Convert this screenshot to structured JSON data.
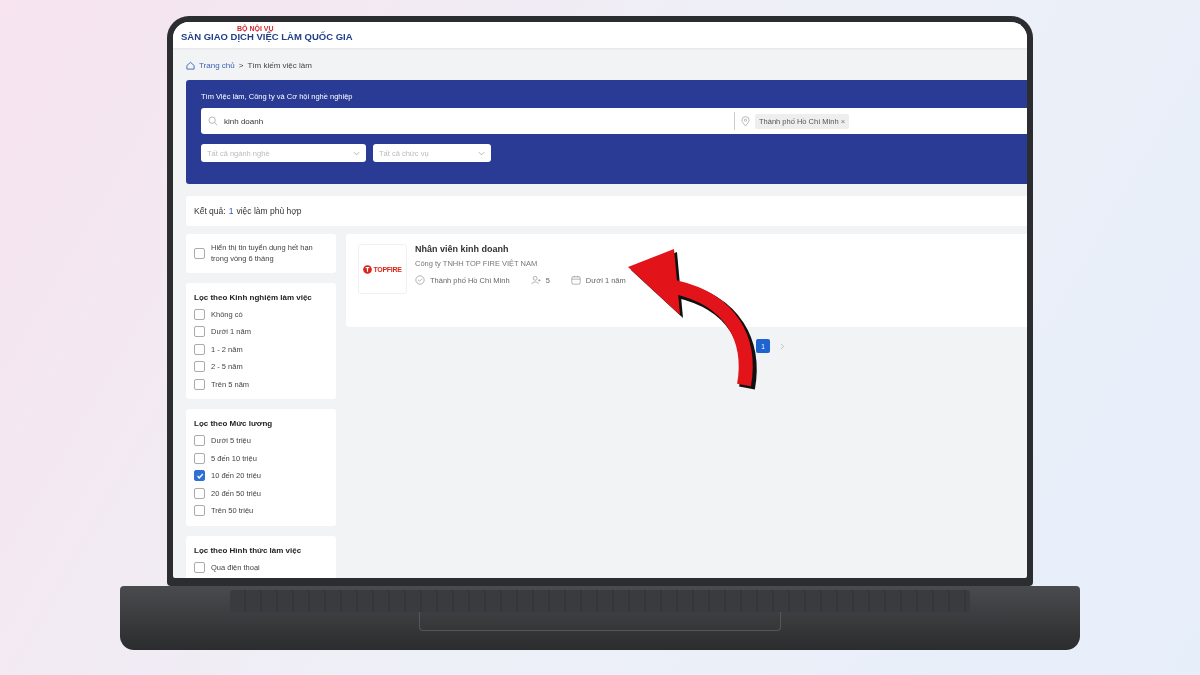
{
  "header": {
    "ministry": "BỘ NỘI VỤ",
    "site_title": "SÀN GIAO DỊCH VIỆC LÀM QUỐC GIA"
  },
  "breadcrumb": {
    "separator": ">",
    "items": [
      {
        "label": "Trang chủ",
        "kind": "link"
      },
      {
        "label": "Tìm kiếm việc làm",
        "kind": "current"
      }
    ]
  },
  "search": {
    "title": "Tìm Việc làm, Công ty và Cơ hội nghề nghiệp",
    "keyword": "kinh doanh",
    "location_tag": "Thành phố Hồ Chí Minh",
    "tag_remove": "×",
    "industry_placeholder": "Tất cả ngành nghề",
    "position_placeholder": "Tất cả chức vụ"
  },
  "results": {
    "label": "Kết quả:",
    "count": "1",
    "suffix": "việc làm phù hợp"
  },
  "expired_toggle": {
    "label": "Hiển thị tin tuyển dụng hết hạn trong vòng 6 tháng",
    "checked": false
  },
  "filter_groups": [
    {
      "title": "Lọc theo Kinh nghiệm làm việc",
      "options": [
        {
          "label": "Không có",
          "checked": false
        },
        {
          "label": "Dưới 1 năm",
          "checked": false
        },
        {
          "label": "1 - 2 năm",
          "checked": false
        },
        {
          "label": "2 - 5 năm",
          "checked": false
        },
        {
          "label": "Trên 5 năm",
          "checked": false
        }
      ]
    },
    {
      "title": "Lọc theo Mức lương",
      "options": [
        {
          "label": "Dưới 5 triệu",
          "checked": false
        },
        {
          "label": "5 đến 10 triệu",
          "checked": false
        },
        {
          "label": "10 đến 20 triệu",
          "checked": true
        },
        {
          "label": "20 đến 50 triệu",
          "checked": false
        },
        {
          "label": "Trên 50 triệu",
          "checked": false
        }
      ]
    },
    {
      "title": "Lọc theo Hình thức làm việc",
      "options": [
        {
          "label": "Qua điện thoại",
          "checked": false
        }
      ]
    }
  ],
  "jobs": [
    {
      "title": "Nhân viên kinh doanh",
      "company": "Công ty TNHH TOP FIRE VIỆT NAM",
      "logo_text": "TOPFIRE",
      "location": "Thành phố Hồ Chí Minh",
      "openings": "5",
      "experience": "Dưới 1 năm"
    }
  ],
  "pagination": {
    "pages": [
      {
        "label": "1",
        "selected": true
      }
    ]
  }
}
